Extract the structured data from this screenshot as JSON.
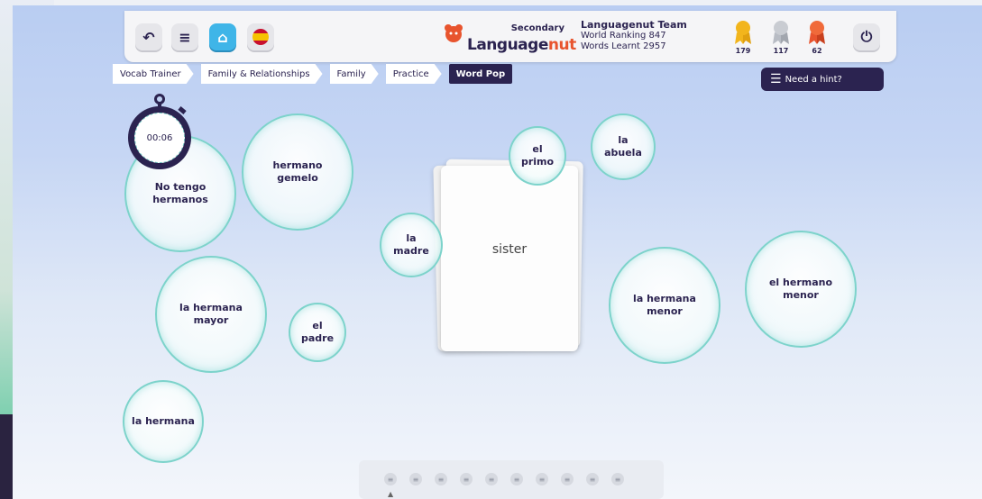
{
  "header": {
    "back_icon": "undo-icon",
    "menu_icon": "menu-icon",
    "home_icon": "home-icon",
    "flag_icon": "spain-flag-icon",
    "brand_sub": "Secondary",
    "brand_main": "Language",
    "brand_accent": "nut",
    "team_name": "Languagenut Team",
    "world_ranking": "World Ranking 847",
    "words_learnt": "Words Learnt 2957",
    "medals": [
      {
        "label": "179",
        "color": "#f2b51c"
      },
      {
        "label": "117",
        "color": "#b8bcc4"
      },
      {
        "label": "62",
        "color": "#e8542e"
      }
    ],
    "power_icon": "power-icon"
  },
  "breadcrumb": [
    "Vocab Trainer",
    "Family & Relationships",
    "Family",
    "Practice",
    "Word Pop"
  ],
  "hint_button": "Need a hint?",
  "timer": "00:06",
  "card_word": "sister",
  "bubbles": {
    "b1": "No tengo hermanos",
    "b2": "hermano gemelo",
    "b3": "el primo",
    "b4": "la abuela",
    "b5": "la madre",
    "b6": "la hermana mayor",
    "b7": "el padre",
    "b8": "la hermana menor",
    "b9": "el hermano menor",
    "b10": "la hermana"
  },
  "colors": {
    "navy": "#2b2350",
    "accent_blue": "#3fb5e8",
    "bubble_border": "#7dd3cb",
    "brand_orange": "#e8542e"
  }
}
